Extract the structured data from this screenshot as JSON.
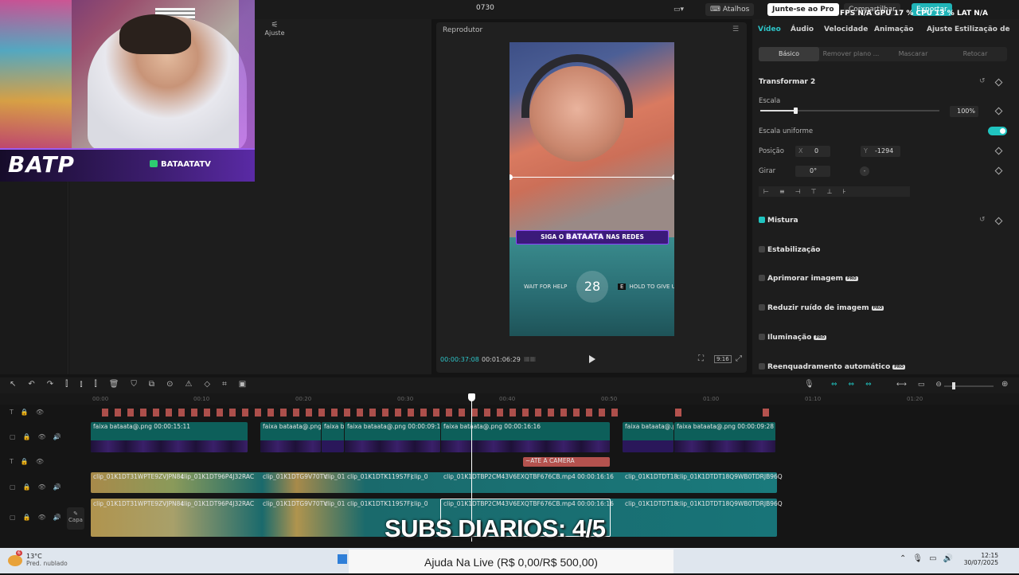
{
  "window": {
    "title": "0730"
  },
  "topbar": {
    "layout_icon": "layout-icon",
    "shortcuts": "Atalhos",
    "pro": "Junte-se ao Pro",
    "share": "Compartilhar",
    "export": "Exportar",
    "stats": "FPS N/A  GPU 17 %  CPU 13 %  LAT N/A"
  },
  "webcam": {
    "logo": "BATP",
    "channel": "BATAATATV"
  },
  "adjust_tab": "Ajuste",
  "player": {
    "title": "Reprodutor",
    "current": "00:00:37:08",
    "total": "00:01:06:29",
    "ratio": "9:16",
    "video": {
      "banner_pre": "SIGA O",
      "banner_name": "BATAATA",
      "banner_post": "NAS REDES",
      "wait": "WAIT FOR HELP",
      "count": "28",
      "key": "E",
      "hold": "HOLD TO GIVE U"
    }
  },
  "panel": {
    "tabs": [
      "Vídeo",
      "Áudio",
      "Velocidade",
      "Animação",
      "Ajuste",
      "Estilização de"
    ],
    "subtabs": [
      "Básico",
      "Remover plano ...",
      "Mascarar",
      "Retocar"
    ],
    "transform": "Transformar 2",
    "scale": "Escala",
    "scale_val": "100%",
    "uniform": "Escala uniforme",
    "position": "Posição",
    "x_lbl": "X",
    "x": "0",
    "y_lbl": "Y",
    "y": "-1294",
    "rotate": "Girar",
    "rotate_val": "0°",
    "blend": "Mistura",
    "stabilize": "Estabilização",
    "enhance": "Aprimorar imagem",
    "noise": "Reduzir ruído de imagem",
    "lighting": "Iluminação",
    "reframe": "Reenquadramento automático",
    "pro": "PRO"
  },
  "ruler": [
    "00:00",
    "00:10",
    "00:20",
    "00:30",
    "00:40",
    "00:50",
    "01:00",
    "01:10",
    "01:20"
  ],
  "tracks": {
    "img_clips": [
      "faixa bataata@.png  00:00:15:11",
      "faixa bataata@.png",
      "faixa ba",
      "faixa bataata@.png  00:00:09:15",
      "faixa bataata@.png  00:00:16:16",
      "faixa bataata@.png",
      "faixa bataata@.png  00:00:09:28"
    ],
    "text_clip": "~ATE A CAMERA",
    "v_clips": [
      "clip_01K1DT31WPTE9ZVJPN84",
      "clip_01K1DT96P4J32RAC",
      "clip_01K1DTG9V70TV",
      "clip_01",
      "clip_01K1DTK119S7F)",
      "clip_0",
      "clip_01K1DTBP2CM43V6EXQTBF676CB.mp4  00:00:16:16",
      "clip_01K1DTDT18",
      "clip_01K1DTDT18Q9WB0TDRJB96Q"
    ],
    "capa": "Capa"
  },
  "subs": "SUBS DIARIOS: 4/5",
  "taskbar": {
    "temp": "13°C",
    "weather": "Pred. nublado",
    "notif": "6",
    "ajuda": "Ajuda Na Live (R$ 0,00/R$ 500,00)",
    "time": "12:15",
    "date": "30/07/2025"
  }
}
